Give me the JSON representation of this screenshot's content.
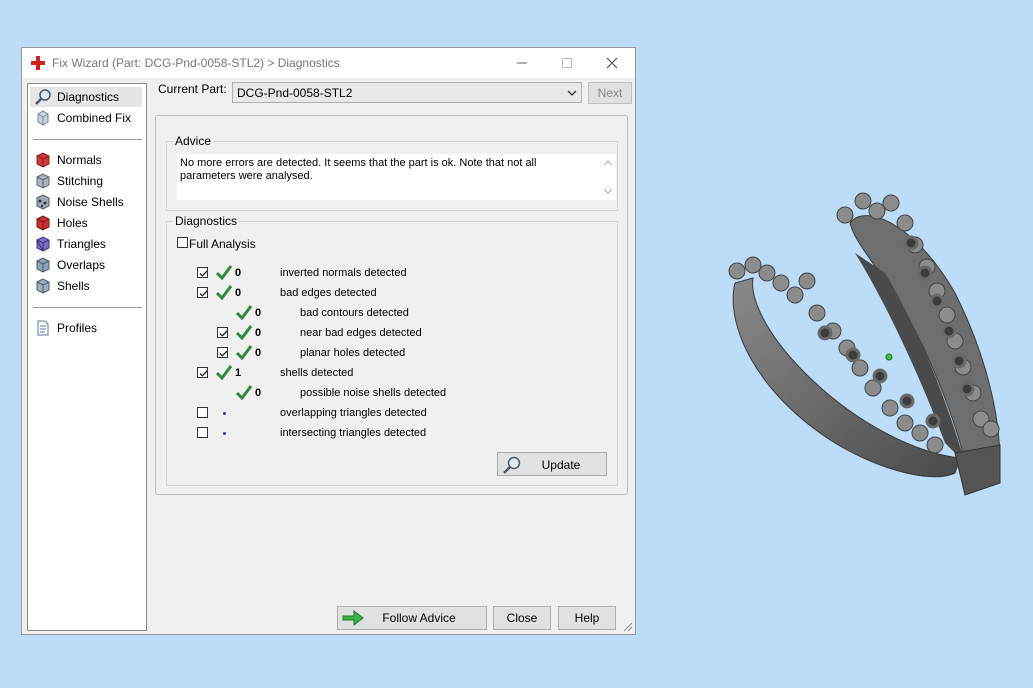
{
  "window": {
    "title": "Fix Wizard (Part: DCG-Pnd-0058-STL2) > Diagnostics"
  },
  "sidebar": {
    "items": [
      {
        "label": "Diagnostics"
      },
      {
        "label": "Combined Fix"
      },
      {
        "label": "Normals"
      },
      {
        "label": "Stitching"
      },
      {
        "label": "Noise Shells"
      },
      {
        "label": "Holes"
      },
      {
        "label": "Triangles"
      },
      {
        "label": "Overlaps"
      },
      {
        "label": "Shells"
      },
      {
        "label": "Profiles"
      }
    ]
  },
  "current_part": {
    "label": "Current Part:",
    "value": "DCG-Pnd-0058-STL2",
    "next_label": "Next"
  },
  "advice": {
    "legend": "Advice",
    "text": "No more errors are detected. It seems that the part is ok. Note that not all parameters were analysed."
  },
  "diagnostics": {
    "legend": "Diagnostics",
    "full_analysis_label": "Full Analysis",
    "rows": [
      {
        "checked": true,
        "status": "ok",
        "count": "0",
        "label": "inverted normals detected"
      },
      {
        "checked": true,
        "status": "ok",
        "count": "0",
        "label": "bad edges detected"
      },
      {
        "checked": null,
        "status": "ok",
        "count": "0",
        "label": "bad contours detected"
      },
      {
        "checked": true,
        "status": "ok",
        "count": "0",
        "label": "near bad edges detected"
      },
      {
        "checked": true,
        "status": "ok",
        "count": "0",
        "label": "planar holes detected"
      },
      {
        "checked": true,
        "status": "ok",
        "count": "1",
        "label": "shells detected"
      },
      {
        "checked": null,
        "status": "ok",
        "count": "0",
        "label": "possible noise shells detected"
      },
      {
        "checked": false,
        "status": "pending",
        "count": "",
        "label": "overlapping triangles detected"
      },
      {
        "checked": false,
        "status": "pending",
        "count": "",
        "label": "intersecting triangles detected"
      }
    ],
    "update_label": "Update"
  },
  "footer": {
    "follow_advice_label": "Follow Advice",
    "close_label": "Close",
    "help_label": "Help"
  },
  "colors": {
    "desktop": "#bcdcf7",
    "tick_green": "#2e8b3a",
    "dot_blue": "#2b3fcf"
  }
}
